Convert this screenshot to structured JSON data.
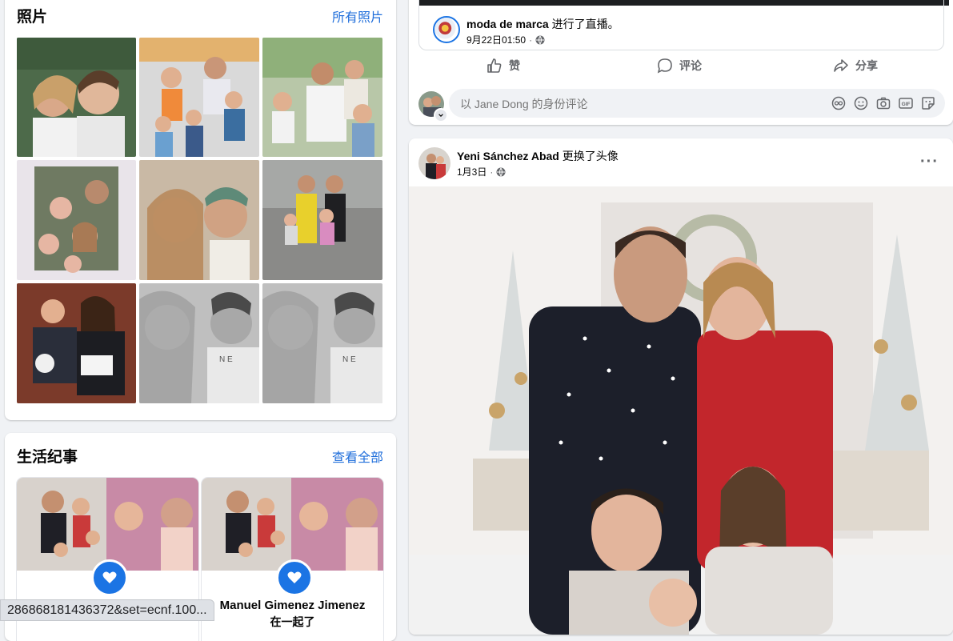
{
  "photos": {
    "title": "照片",
    "link": "所有照片"
  },
  "life_events": {
    "title": "生活纪事",
    "link": "查看全部",
    "items": [
      {
        "name": ""
      },
      {
        "name": "Manuel Gimenez Jimenez",
        "subtitle": "在一起了"
      }
    ]
  },
  "top_post": {
    "author": "moda de marca",
    "action": "进行了直播。",
    "time": "9月22日01:50",
    "privacy_icon": "globe-icon",
    "actions": {
      "like": "赞",
      "comment": "评论",
      "share": "分享"
    },
    "comment_placeholder": "以 Jane Dong 的身份评论",
    "comment_icons": [
      "avatar-sticker-icon",
      "emoji-icon",
      "camera-icon",
      "gif-icon",
      "sticker-icon"
    ]
  },
  "main_post": {
    "author": "Yeni Sánchez Abad",
    "action": "更换了头像",
    "time": "1月3日",
    "privacy_icon": "globe-icon",
    "more_icon": "more-options-icon"
  },
  "status_url": "286868181436372&set=ecnf.100...",
  "colors": {
    "link": "#216fdb",
    "accent": "#1b74e4",
    "background": "#f0f2f5"
  }
}
